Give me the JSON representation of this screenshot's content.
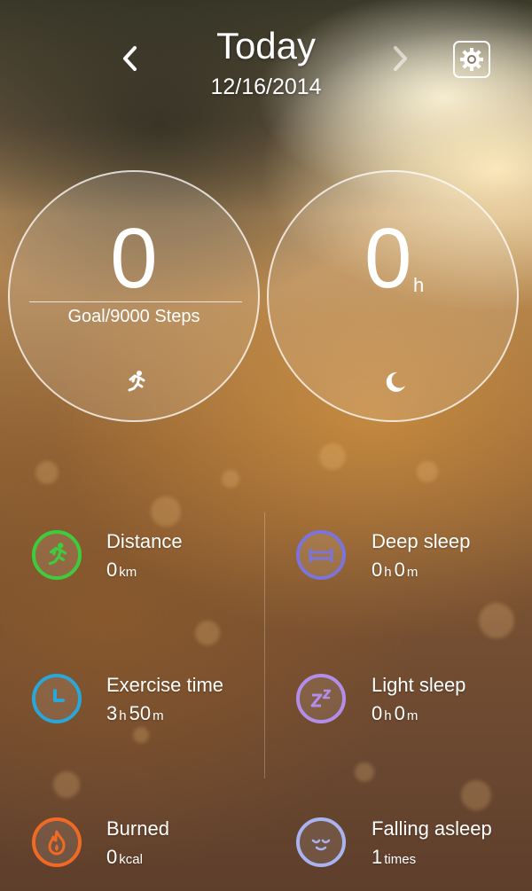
{
  "header": {
    "title": "Today",
    "date": "12/16/2014",
    "prev_icon": "chevron-left-icon",
    "next_icon": "chevron-right-icon",
    "settings_icon": "gear-icon"
  },
  "steps_card": {
    "value": "0",
    "goal_text": "Goal/9000 Steps",
    "icon": "running-person-icon"
  },
  "sleep_card": {
    "value": "0",
    "unit": "h",
    "icon": "moon-icon"
  },
  "stats": {
    "distance": {
      "label": "Distance",
      "value": "0",
      "unit": "km",
      "icon": "running-person-icon",
      "color": "#3ecb3e"
    },
    "exercise": {
      "label": "Exercise time",
      "hours": "3",
      "hours_unit": "h",
      "minutes": "50",
      "minutes_unit": "m",
      "icon": "clock-icon",
      "color": "#2aa7d9"
    },
    "burned": {
      "label": "Burned",
      "value": "0",
      "unit": "kcal",
      "icon": "flame-icon",
      "color": "#f06a26"
    },
    "deep_sleep": {
      "label": "Deep sleep",
      "hours": "0",
      "hours_unit": "h",
      "minutes": "0",
      "minutes_unit": "m",
      "icon": "bed-icon",
      "color": "#7c74db"
    },
    "light_sleep": {
      "label": "Light sleep",
      "hours": "0",
      "hours_unit": "h",
      "minutes": "0",
      "minutes_unit": "m",
      "icon": "zz-icon",
      "color": "#b38ee8"
    },
    "falling_asleep": {
      "label": "Falling asleep",
      "value": "1",
      "unit": "times",
      "icon": "sleeping-face-icon",
      "color": "#a8b3f0"
    }
  }
}
